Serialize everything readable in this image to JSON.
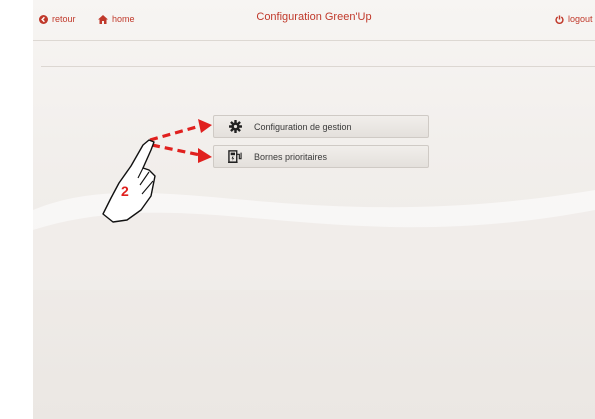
{
  "header": {
    "back_label": "retour",
    "home_label": "home",
    "title": "Configuration Green'Up",
    "logout_label": "logout"
  },
  "menu": {
    "items": [
      {
        "label": "Configuration de gestion",
        "icon": "gear-icon"
      },
      {
        "label": "Bornes prioritaires",
        "icon": "charging-station-icon"
      }
    ]
  },
  "annotation": {
    "step_number": "2"
  },
  "colors": {
    "accent": "#c0392b",
    "annotation_red": "#e0201e"
  }
}
